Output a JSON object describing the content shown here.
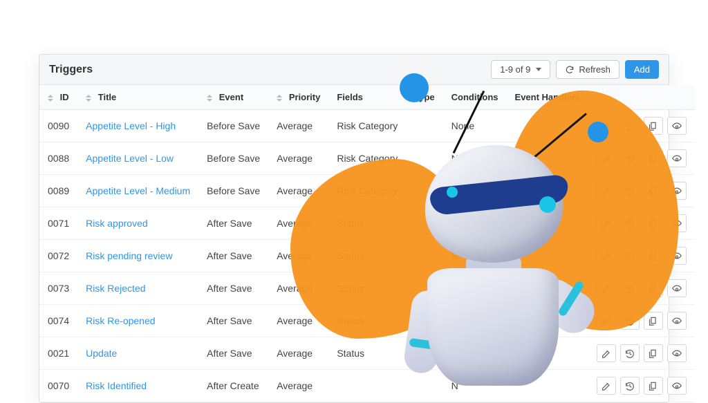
{
  "header": {
    "title": "Triggers",
    "range_label": "1-9 of 9",
    "refresh_label": "Refresh",
    "add_label": "Add"
  },
  "columns": {
    "id": "ID",
    "title": "Title",
    "event": "Event",
    "priority": "Priority",
    "fields": "Fields",
    "type": "Type",
    "conditions": "Conditions",
    "event_handlers": "Event Handlers"
  },
  "rows": [
    {
      "id": "0090",
      "title": "Appetite Level - High",
      "event": "Before Save",
      "priority": "Average",
      "fields": "Risk Category",
      "type": "",
      "conditions": "None",
      "handlers": ""
    },
    {
      "id": "0088",
      "title": "Appetite Level - Low",
      "event": "Before Save",
      "priority": "Average",
      "fields": "Risk Category",
      "type": "",
      "conditions": "None",
      "handlers": ""
    },
    {
      "id": "0089",
      "title": "Appetite Level - Medium",
      "event": "Before Save",
      "priority": "Average",
      "fields": "Risk Category",
      "type": "",
      "conditions": "N",
      "handlers": ""
    },
    {
      "id": "0071",
      "title": "Risk approved",
      "event": "After Save",
      "priority": "Average",
      "fields": "Status",
      "type": "",
      "conditions": "N",
      "handlers": ""
    },
    {
      "id": "0072",
      "title": "Risk pending review",
      "event": "After Save",
      "priority": "Average",
      "fields": "Status",
      "type": "",
      "conditions": "N",
      "handlers": ""
    },
    {
      "id": "0073",
      "title": "Risk Rejected",
      "event": "After Save",
      "priority": "Average",
      "fields": "Status",
      "type": "",
      "conditions": "",
      "handlers": ""
    },
    {
      "id": "0074",
      "title": "Risk Re-opened",
      "event": "After Save",
      "priority": "Average",
      "fields": "Status",
      "type": "",
      "conditions": "",
      "handlers": ""
    },
    {
      "id": "0021",
      "title": "Update",
      "event": "After Save",
      "priority": "Average",
      "fields": "Status",
      "type": "",
      "conditions": "",
      "handlers": ""
    },
    {
      "id": "0070",
      "title": "Risk Identified",
      "event": "After Create",
      "priority": "Average",
      "fields": "",
      "type": "",
      "conditions": "N",
      "handlers": ""
    }
  ],
  "row_action_icons": [
    "edit-icon",
    "history-icon",
    "copy-icon",
    "view-icon"
  ]
}
